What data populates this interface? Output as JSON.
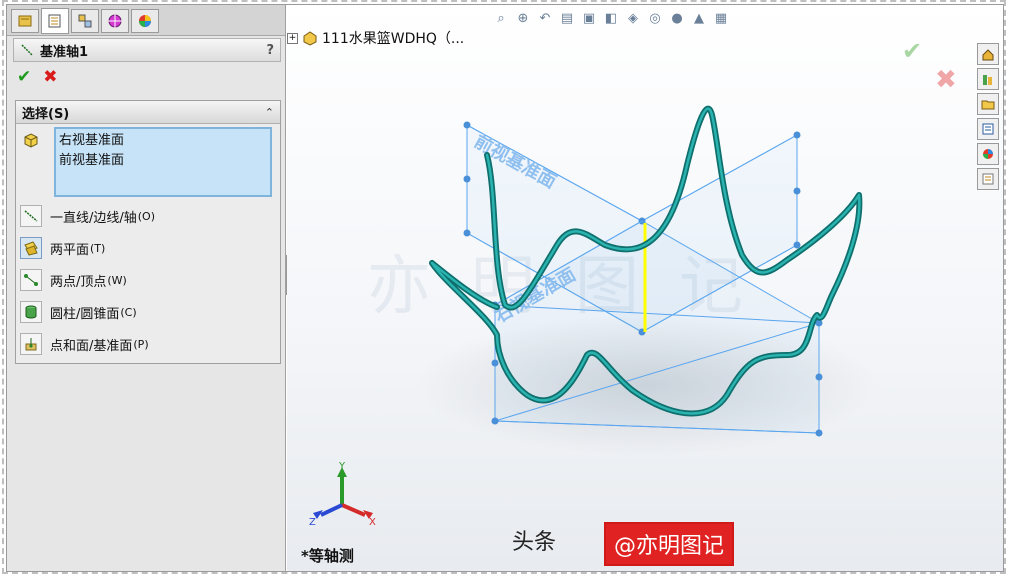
{
  "panel": {
    "feature_title": "基准轴1",
    "help": "?",
    "ok_symbol": "✔",
    "cancel_symbol": "✖",
    "group_title": "选择(S)",
    "collapse_symbol": "⌃",
    "selections": [
      "右视基准面",
      "前视基准面"
    ],
    "options": [
      {
        "label": "一直线/边线/轴",
        "key": "(O)"
      },
      {
        "label": "两平面",
        "key": "(T)"
      },
      {
        "label": "两点/顶点",
        "key": "(W)"
      },
      {
        "label": "圆柱/圆锥面",
        "key": "(C)"
      },
      {
        "label": "点和面/基准面",
        "key": "(P)"
      }
    ],
    "tabs": [
      "feature-manager-icon",
      "property-manager-icon",
      "configuration-manager-icon",
      "dimxpert-icon",
      "display-manager-icon"
    ]
  },
  "view": {
    "tree_label": "111水果篮WDHQ（...",
    "tree_expand": "+",
    "plane_front": "前视基准面",
    "plane_right": "右视基准面",
    "view_name": "*等轴测",
    "axis_labels": {
      "x": "X",
      "y": "Y",
      "z": "Z"
    },
    "watermark_faint": "亦明图记"
  },
  "watermark": {
    "prefix": "头条",
    "handle": "@亦明图记"
  },
  "colors": {
    "curve": "#1a9a98",
    "plane": "#5aa6ef",
    "axis": "#ffff00",
    "selection": "#c7e3f8"
  }
}
